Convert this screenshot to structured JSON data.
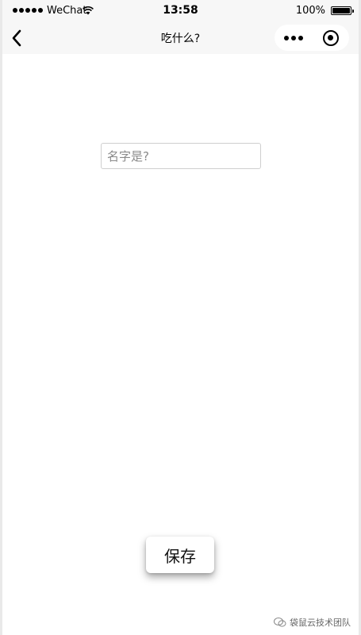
{
  "status_bar": {
    "carrier": "WeChat",
    "time": "13:58",
    "battery": "100%"
  },
  "nav": {
    "title": "吃什么?",
    "icons": [
      "back-icon",
      "more-dots-icon",
      "target-close-icon"
    ]
  },
  "form": {
    "name_placeholder": "名字是?",
    "name_value": ""
  },
  "actions": {
    "save_label": "保存"
  },
  "watermark": {
    "text": "袋鼠云技术团队"
  },
  "colors": {
    "bar_bg": "#f7f7f7",
    "page_bg": "#ffffff",
    "input_border": "#cfcfcf"
  }
}
